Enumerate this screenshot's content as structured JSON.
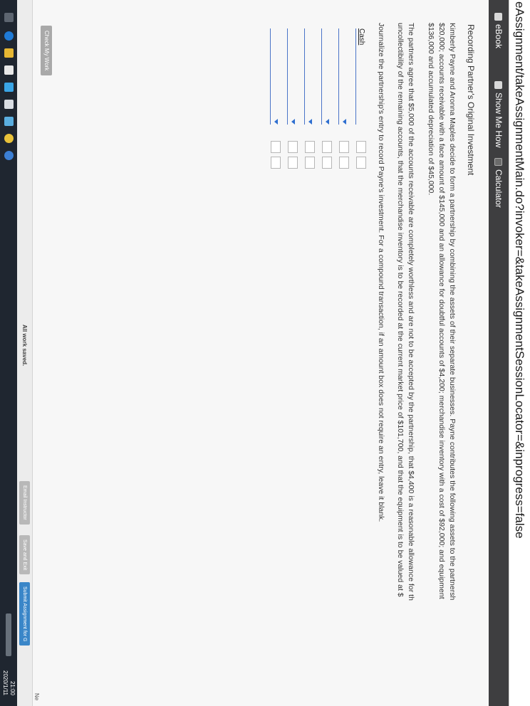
{
  "browser": {
    "url": "eAssignment/takeAssignmentMain.do?invoker=&takeAssignmentSessionLocator=&inprogress=false"
  },
  "toolbar": {
    "ebook_label": "eBook",
    "show_me_how_label": "Show Me How",
    "calculator_label": "Calculator"
  },
  "problem": {
    "title": "Recording Partner's Original Investment",
    "paragraph1": [
      "Kimberly Payne and Aronna Maples decide to form a partnership by combining the assets of their separate businesses. Payne contributes the following assets to the partnersh",
      "$20,000; accounts receivable with a face amount of $145,000 and an allowance for doubtful accounts of $4,200; merchandise inventory with a cost of $92,000; and equipment",
      "$136,000 and accumulated depreciation of $45,000."
    ],
    "paragraph2": [
      "The partners agree that $5,000 of the accounts receivable are completely worthless and are not to be accepted by the partnership, that $4,400 is a reasonable allowance for th",
      "uncollectibility of the remaining accounts, that the merchandise inventory is to be recorded at the current market price of $101,700, and that the equipment is to be valued at $"
    ],
    "instruction": "Journalize the partnership's entry to record Payne's investment. For a compound transaction, if an amount box does not require an entry, leave it blank."
  },
  "journal": {
    "rows": [
      {
        "account": "Cash",
        "has_dropdown": false
      },
      {
        "account": "",
        "has_dropdown": true
      },
      {
        "account": "",
        "has_dropdown": true
      },
      {
        "account": "",
        "has_dropdown": true
      },
      {
        "account": "",
        "has_dropdown": true
      },
      {
        "account": "",
        "has_dropdown": true
      }
    ]
  },
  "buttons": {
    "check_my_work": "Check My Work",
    "back_glyph": "<"
  },
  "status": {
    "saved_text": "All work saved.",
    "email_instructor": "Email Instructor",
    "save_and_exit": "Save and Exit",
    "submit": "Submit Assignment for G",
    "next_text": "Ne"
  },
  "taskbar": {
    "time": "21:00",
    "date": "2020/1/11"
  },
  "colors": {
    "toolbar_bg": "#3e3e40",
    "link_blue": "#2f6fd0",
    "submit_blue": "#3a86c8"
  }
}
